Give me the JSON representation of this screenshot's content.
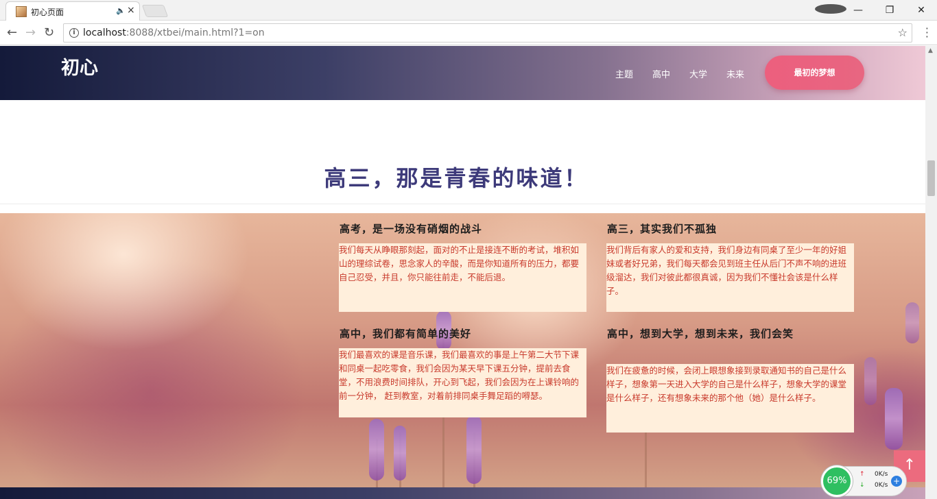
{
  "browser": {
    "tab_title": "初心页面",
    "url_host": "localhost",
    "url_rest": ":8088/xtbei/main.html?1=on"
  },
  "header": {
    "logo": "初心",
    "nav": [
      "主题",
      "高中",
      "大学",
      "未来"
    ],
    "cta": "最初的梦想"
  },
  "section": {
    "title": "高三，那是青春的味道！"
  },
  "cards": [
    {
      "title": "高考，是一场没有硝烟的战斗",
      "body": "我们每天从睁眼那刻起，面对的不止是接连不断的考试，堆积如山的理综试卷，思念家人的辛酸，而是你知道所有的压力，都要自己忍受，并且，你只能往前走，不能后退。"
    },
    {
      "title": "高三，其实我们不孤独",
      "body": "我们背后有家人的爱和支持，我们身边有同桌了至少一年的好姐妹或者好兄弟，我们每天都会见到班主任从后门不声不响的进班级溜达，我们对彼此都很真诚，因为我们不懂社会该是什么样子。"
    },
    {
      "title": "高中，我们都有简单的美好",
      "body": "我们最喜欢的课是音乐课，我们最喜欢的事是上午第二大节下课和同桌一起吃零食，我们会因为某天早下课五分钟，提前去食堂，不用浪费时间排队，开心到飞起，我们会因为在上课铃响的前一分钟， 赶到教室，对着前排同桌手舞足蹈的嘚瑟。"
    },
    {
      "title": "高中，想到大学，想到未来，我们会笑",
      "body": "我们在疲惫的时候，会闭上眼想象接到录取通知书的自己是什么样子，想象第一天进入大学的自己是什么样子，想象大学的课堂是什么样子，还有想象未来的那个他（她）是什么样子。"
    }
  ],
  "widgets": {
    "cpu": "69%",
    "up": "0K/s",
    "down": "0K/s"
  }
}
